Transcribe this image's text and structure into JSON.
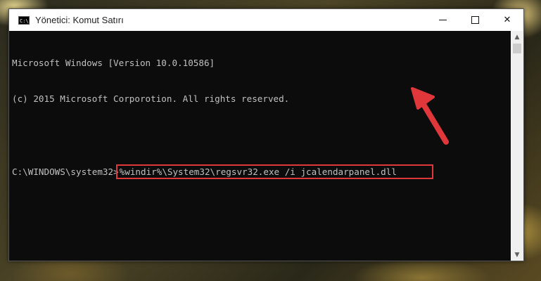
{
  "window": {
    "title": "Yönetici: Komut Satırı",
    "icon_label": "C:\\",
    "controls": {
      "minimize": "—",
      "maximize": "☐",
      "close": "✕"
    }
  },
  "console": {
    "lines": [
      "Microsoft Windows [Version 10.0.10586]",
      "(c) 2015 Microsoft Corporotion. All rights reserved."
    ],
    "prompt": "C:\\WINDOWS\\system32>",
    "command": "%windir%\\System32\\regsvr32.exe /i jcalendarpanel.dll"
  },
  "annotation": {
    "highlight_color": "#e0373a",
    "arrow_color": "#e0373a",
    "arrow_icon": "red-pointer-arrow"
  },
  "scrollbar": {
    "up_icon": "scroll-up-arrow-icon",
    "down_icon": "scroll-down-arrow-icon"
  }
}
